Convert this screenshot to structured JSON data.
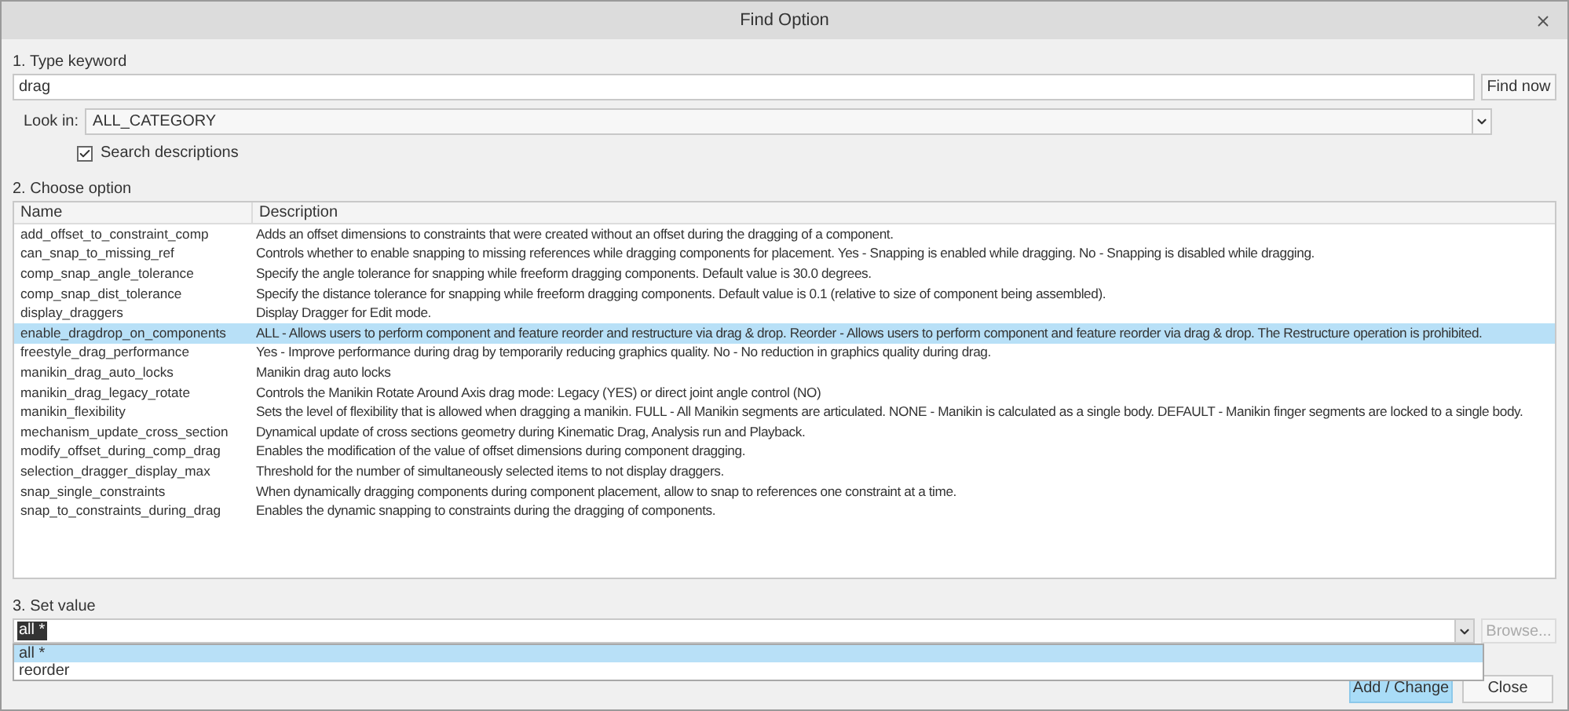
{
  "window": {
    "title": "Find Option"
  },
  "keyword": {
    "label": "1.  Type keyword",
    "value": "drag",
    "button": "Find now"
  },
  "look_in": {
    "label": "Look in:",
    "value": "ALL_CATEGORY"
  },
  "search_descriptions": {
    "label": "Search descriptions",
    "checked": true
  },
  "options": {
    "label": "2.  Choose option",
    "columns": [
      "Name",
      "Description"
    ],
    "rows": [
      {
        "name": "add_offset_to_constraint_comp",
        "description": "Adds an offset dimensions to constraints that were created without an offset during the dragging of a component.",
        "selected": false
      },
      {
        "name": "can_snap_to_missing_ref",
        "description": "Controls whether to enable snapping to missing references while dragging components for placement. Yes - Snapping is enabled while dragging. No - Snapping is disabled while dragging.",
        "selected": false
      },
      {
        "name": "comp_snap_angle_tolerance",
        "description": "Specify the angle tolerance for snapping while freeform dragging components. Default value is 30.0 degrees.",
        "selected": false
      },
      {
        "name": "comp_snap_dist_tolerance",
        "description": "Specify the distance tolerance for snapping while freeform dragging components.  Default value is 0.1 (relative to size of component being assembled).",
        "selected": false
      },
      {
        "name": "display_draggers",
        "description": "Display Dragger for Edit mode.",
        "selected": false
      },
      {
        "name": "enable_dragdrop_on_components",
        "description": "ALL - Allows users to perform component and feature reorder and restructure via drag & drop. Reorder - Allows users to perform component and feature reorder via drag & drop. The Restructure operation is prohibited.",
        "selected": true
      },
      {
        "name": "freestyle_drag_performance",
        "description": "Yes - Improve performance during drag by temporarily reducing graphics quality. No - No reduction in graphics quality during drag.",
        "selected": false
      },
      {
        "name": "manikin_drag_auto_locks",
        "description": "Manikin drag auto locks",
        "selected": false
      },
      {
        "name": "manikin_drag_legacy_rotate",
        "description": "Controls the Manikin Rotate Around Axis drag mode: Legacy (YES) or direct joint angle control (NO)",
        "selected": false
      },
      {
        "name": "manikin_flexibility",
        "description": "Sets the level of flexibility that is allowed when dragging a manikin. FULL - All Manikin segments are articulated.  NONE - Manikin is calculated as a single body. DEFAULT - Manikin finger segments are locked to a single body.",
        "selected": false
      },
      {
        "name": "mechanism_update_cross_section",
        "description": "Dynamical update of cross sections geometry during Kinematic Drag, Analysis run and Playback.",
        "selected": false
      },
      {
        "name": "modify_offset_during_comp_drag",
        "description": "Enables the modification of the value of offset dimensions during component dragging.",
        "selected": false
      },
      {
        "name": "selection_dragger_display_max",
        "description": "Threshold for the number of simultaneously selected items to not display draggers.",
        "selected": false
      },
      {
        "name": "snap_single_constraints",
        "description": "When dynamically dragging components during component placement, allow to snap to references one constraint at a time.",
        "selected": false
      },
      {
        "name": "snap_to_constraints_during_drag",
        "description": "Enables the dynamic snapping to constraints during the dragging of components.",
        "selected": false
      }
    ]
  },
  "set_value": {
    "label": "3.  Set value",
    "value": "all *",
    "browse": {
      "label": "Browse...",
      "disabled": true
    },
    "dropdown": [
      {
        "label": "all *",
        "selected": true
      },
      {
        "label": "reorder",
        "selected": false
      }
    ]
  },
  "buttons": [
    {
      "label": "Add / Change",
      "kind": "primary"
    },
    {
      "label": "Close",
      "kind": "normal"
    }
  ]
}
